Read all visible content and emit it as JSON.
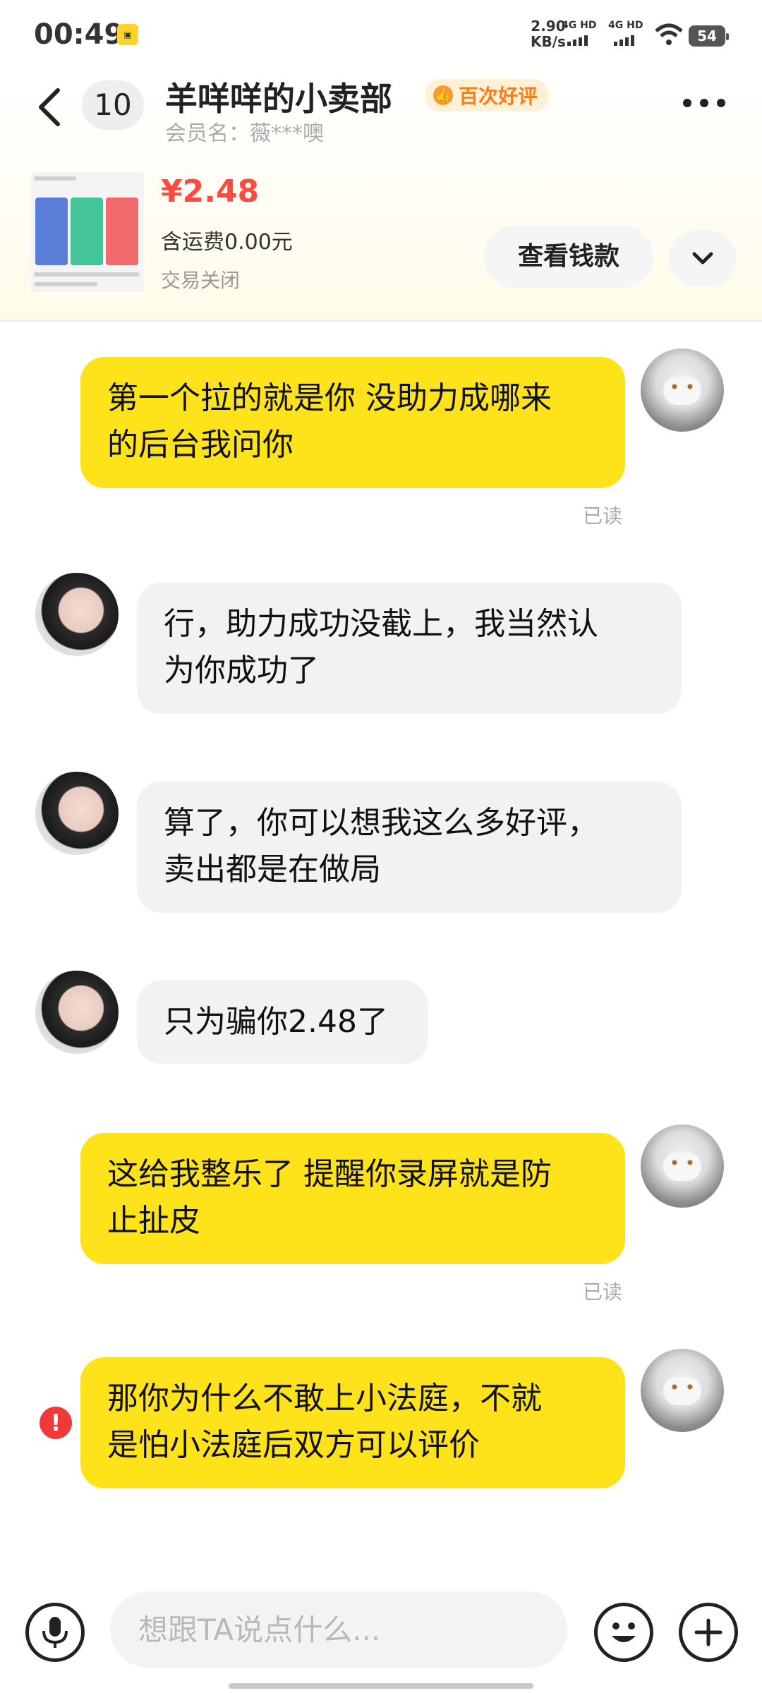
{
  "status_bar": {
    "time": "00:49",
    "speed_value": "2.90",
    "speed_unit": "KB/s",
    "signal1": "4G HD",
    "signal2": "4G HD",
    "battery": "54"
  },
  "header": {
    "unread_count": "10",
    "title": "羊咩咩的小卖部",
    "badge": "百次好评",
    "member_label": "会员名：薇***噢"
  },
  "product": {
    "price": "¥2.48",
    "shipping": "含运费0.00元",
    "status": "交易关闭",
    "view_button": "查看钱款"
  },
  "messages": [
    {
      "sender": "me",
      "line1": "第一个拉的就是你 没助力成哪来",
      "line2": "的后台我问你",
      "read": "已读"
    },
    {
      "sender": "them",
      "line1": "行，助力成功没截上，我当然认",
      "line2": "为你成功了"
    },
    {
      "sender": "them",
      "line1": "算了，你可以想我这么多好评，",
      "line2": "卖出都是在做局"
    },
    {
      "sender": "them",
      "line1": "只为骗你2.48了"
    },
    {
      "sender": "me",
      "line1": "这给我整乐了 提醒你录屏就是防",
      "line2": "止扯皮",
      "read": "已读"
    },
    {
      "sender": "me",
      "line1": "那你为什么不敢上小法庭，不就",
      "line2": "是怕小法庭后双方可以评价",
      "failed": true
    }
  ],
  "input": {
    "placeholder": "想跟TA说点什么..."
  },
  "colors": {
    "my_bubble": "#ffe31a",
    "their_bubble": "#f2f2f2",
    "price": "#ff4b3e",
    "badge_text": "#ff7b1a",
    "error": "#f03a3a"
  }
}
